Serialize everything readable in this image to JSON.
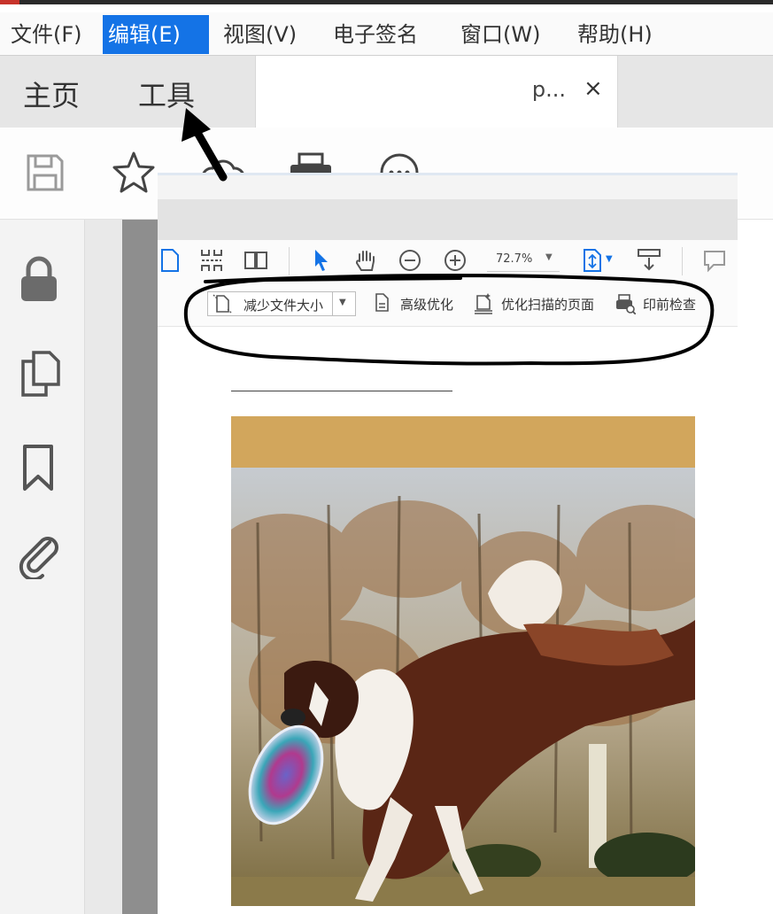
{
  "menubar": {
    "items": [
      "文件(F)",
      "编辑(E)",
      "视图(V)",
      "电子签名",
      "窗口(W)",
      "帮助(H)"
    ],
    "active_index": 1,
    "active_color": "#1473e6"
  },
  "tabs": {
    "home": "主页",
    "tools": "工具",
    "document": "p...",
    "close": "×"
  },
  "toolbar": {
    "icons": [
      "save-icon",
      "star-icon",
      "cloud-upload-icon",
      "print-icon",
      "more-icon"
    ]
  },
  "sidebar": {
    "icons": [
      "lock-icon",
      "copy-pages-icon",
      "bookmark-icon",
      "attachment-icon"
    ]
  },
  "overlay_toolbar": {
    "icons": [
      "page-icon",
      "organize-pages-icon",
      "two-page-icon",
      "select-pointer-icon",
      "hand-icon",
      "zoom-out-icon",
      "zoom-in-icon",
      "fit-page-icon",
      "scroll-mode-icon",
      "comment-icon"
    ],
    "zoom": "72.7%",
    "accent_color": "#1473e6"
  },
  "optimize_bar": {
    "reduce_size": "减少文件大小",
    "advanced": "高级优化",
    "optimize_scanned": "优化扫描的页面",
    "preflight": "印前检查"
  },
  "document": {
    "band_color": "#d2a65c",
    "photo_subject": "border collie jumping with frisbee"
  },
  "annotations": {
    "arrow": "arrow-to-tools-tab",
    "circle": "circle-around-optimize-bar"
  }
}
